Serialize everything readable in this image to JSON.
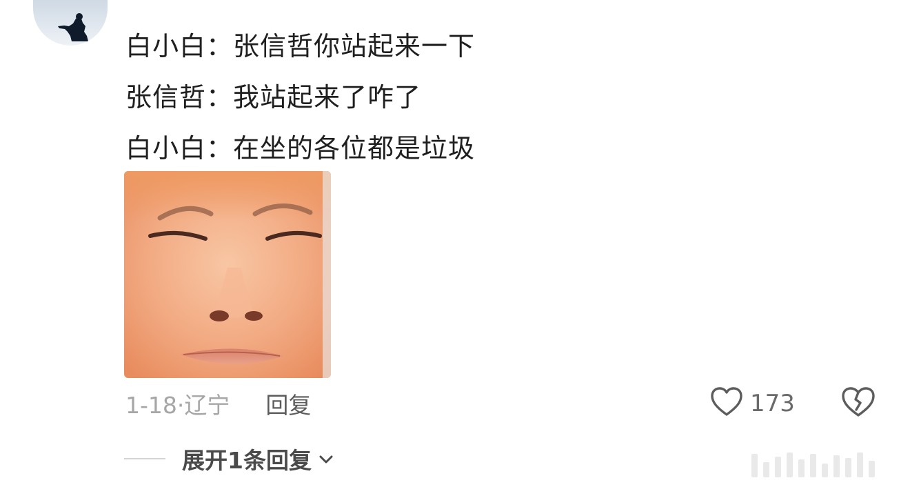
{
  "comment": {
    "lines": [
      "白小白：张信哲你站起来一下",
      "张信哲：我站起来了咋了",
      "白小白：在坐的各位都是垃圾"
    ]
  },
  "meta": {
    "date_location": "1-18·辽宁",
    "reply_label": "回复"
  },
  "actions": {
    "like_count": "173",
    "like_icon": "heart-outline-icon",
    "dislike_icon": "broken-heart-icon"
  },
  "expand": {
    "label": "展开1条回复",
    "icon": "chevron-down-icon"
  }
}
